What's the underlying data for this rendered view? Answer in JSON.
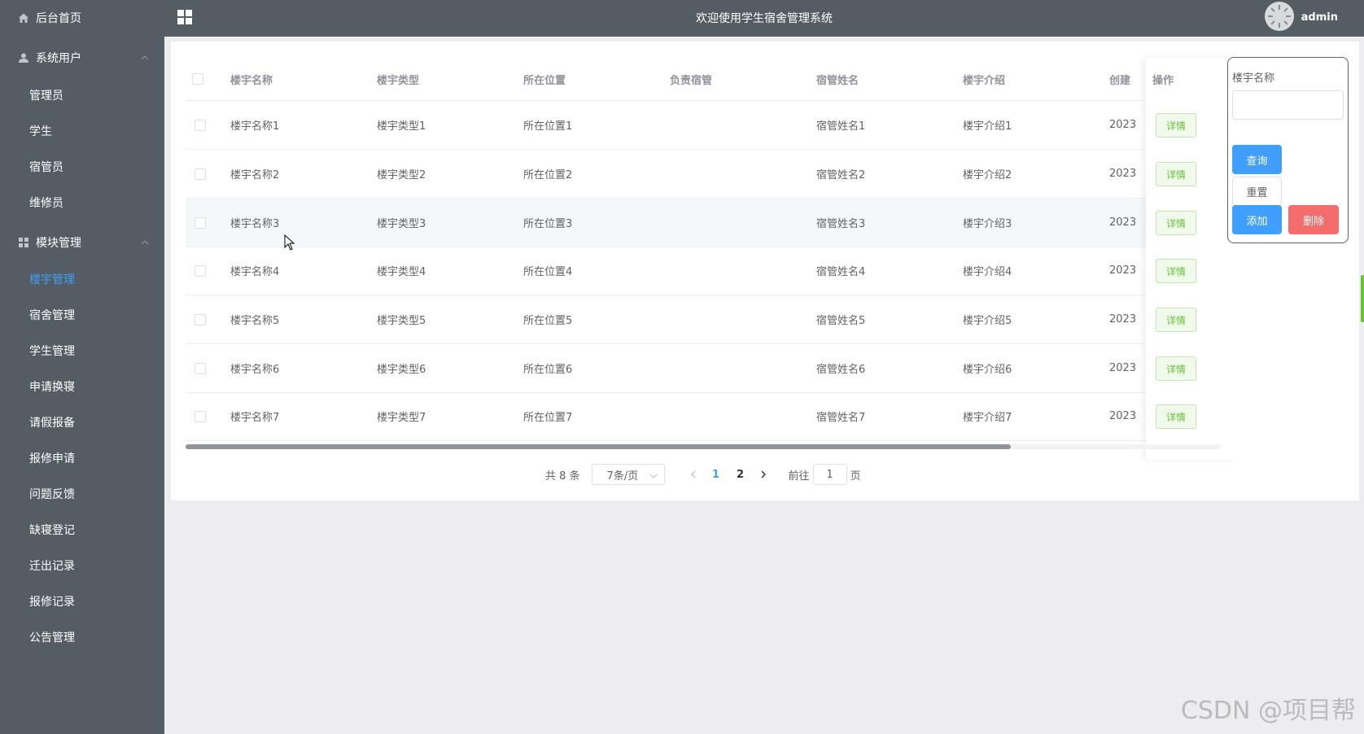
{
  "app": {
    "title": "欢迎使用学生宿舍管理系统",
    "username": "admin",
    "accent_color": "#409eff"
  },
  "sidebar": {
    "items": [
      {
        "label": "后台首页",
        "icon": "home-icon",
        "type": "group"
      },
      {
        "label": "系统用户",
        "icon": "user-icon",
        "type": "group",
        "expandable": true
      },
      {
        "label": "管理员",
        "type": "sub"
      },
      {
        "label": "学生",
        "type": "sub"
      },
      {
        "label": "宿管员",
        "type": "sub"
      },
      {
        "label": "维修员",
        "type": "sub"
      },
      {
        "label": "模块管理",
        "icon": "grid-icon",
        "type": "group",
        "expandable": true
      },
      {
        "label": "楼宇管理",
        "type": "sub",
        "active": true
      },
      {
        "label": "宿舍管理",
        "type": "sub"
      },
      {
        "label": "学生管理",
        "type": "sub"
      },
      {
        "label": "申请换寝",
        "type": "sub"
      },
      {
        "label": "请假报备",
        "type": "sub"
      },
      {
        "label": "报修申请",
        "type": "sub"
      },
      {
        "label": "问题反馈",
        "type": "sub"
      },
      {
        "label": "缺寝登记",
        "type": "sub"
      },
      {
        "label": "迁出记录",
        "type": "sub"
      },
      {
        "label": "报修记录",
        "type": "sub"
      },
      {
        "label": "公告管理",
        "type": "sub"
      }
    ]
  },
  "table": {
    "columns": [
      "楼宇名称",
      "楼宇类型",
      "所在位置",
      "负责宿管",
      "宿管姓名",
      "楼宇介绍",
      "创建",
      "操作"
    ],
    "rows": [
      {
        "name": "楼宇名称1",
        "type": "楼宇类型1",
        "location": "所在位置1",
        "manager": "",
        "manager_name": "宿管姓名1",
        "intro": "楼宇介绍1",
        "created": "2023",
        "action": "详情"
      },
      {
        "name": "楼宇名称2",
        "type": "楼宇类型2",
        "location": "所在位置2",
        "manager": "",
        "manager_name": "宿管姓名2",
        "intro": "楼宇介绍2",
        "created": "2023",
        "action": "详情"
      },
      {
        "name": "楼宇名称3",
        "type": "楼宇类型3",
        "location": "所在位置3",
        "manager": "",
        "manager_name": "宿管姓名3",
        "intro": "楼宇介绍3",
        "created": "2023",
        "action": "详情"
      },
      {
        "name": "楼宇名称4",
        "type": "楼宇类型4",
        "location": "所在位置4",
        "manager": "",
        "manager_name": "宿管姓名4",
        "intro": "楼宇介绍4",
        "created": "2023",
        "action": "详情"
      },
      {
        "name": "楼宇名称5",
        "type": "楼宇类型5",
        "location": "所在位置5",
        "manager": "",
        "manager_name": "宿管姓名5",
        "intro": "楼宇介绍5",
        "created": "2023",
        "action": "详情"
      },
      {
        "name": "楼宇名称6",
        "type": "楼宇类型6",
        "location": "所在位置6",
        "manager": "",
        "manager_name": "宿管姓名6",
        "intro": "楼宇介绍6",
        "created": "2023",
        "action": "详情"
      },
      {
        "name": "楼宇名称7",
        "type": "楼宇类型7",
        "location": "所在位置7",
        "manager": "",
        "manager_name": "宿管姓名7",
        "intro": "楼宇介绍7",
        "created": "2023",
        "action": "详情"
      }
    ]
  },
  "pagination": {
    "total": "共 8 条",
    "page_size": "7条/页",
    "pages": [
      "1",
      "2"
    ],
    "current_page": "1",
    "goto_label": "前往",
    "goto_value": "1",
    "page_suffix": "页"
  },
  "search": {
    "field_label": "楼宇名称",
    "field_value": "",
    "query_label": "查询",
    "reset_label": "重置",
    "add_label": "添加",
    "delete_label": "删除"
  },
  "watermark": "CSDN @项目帮"
}
